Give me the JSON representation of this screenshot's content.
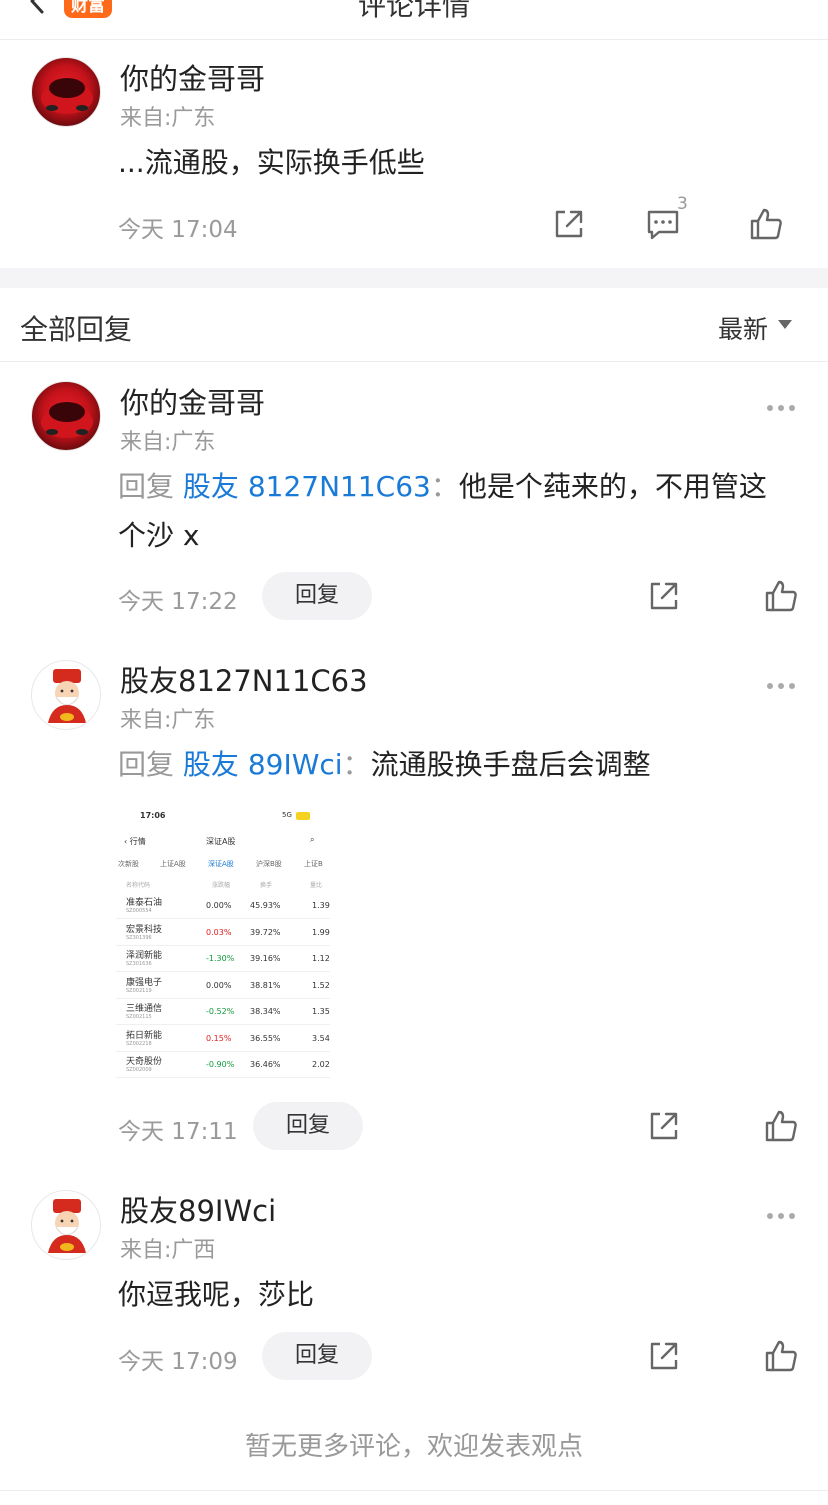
{
  "header": {
    "title": "评论详情",
    "brand_badge": "财富"
  },
  "main_post": {
    "username": "你的金哥哥",
    "region": "来自:广东",
    "content": "...流通股，实际换手低些",
    "time": "今天 17:04",
    "reply_count": "3"
  },
  "replies_section": {
    "title": "全部回复",
    "sort_label": "最新"
  },
  "replies": [
    {
      "username": "你的金哥哥",
      "region": "来自:广东",
      "reply_prefix": "回复",
      "mention": "股友 8127N11C63",
      "colon": "：",
      "text_line1": "他是个莼来的，不用管这",
      "text_line2": "个沙 x",
      "time": "今天 17:22",
      "reply_label": "回复"
    },
    {
      "username": "股友8127N11C63",
      "region": "来自:广东",
      "reply_prefix": "回复",
      "mention": "股友 89IWci",
      "colon": "：",
      "text_line1": "流通股换手盘后会调整",
      "time": "今天 17:11",
      "reply_label": "回复"
    },
    {
      "username": "股友89IWci",
      "region": "来自:广西",
      "text_line1": "你逗我呢，莎比",
      "time": "今天 17:09",
      "reply_label": "回复"
    }
  ],
  "embedded_screenshot": {
    "status_time": "17:06",
    "status_net": "5G",
    "nav_back": "行情",
    "nav_title": "深证A股",
    "tabs": [
      "次新股",
      "上证A股",
      "深证A股",
      "沪深B股",
      "上证B"
    ],
    "columns": [
      "名称代码",
      "涨跌幅",
      "换手",
      "量比"
    ],
    "rows": [
      {
        "name": "准泰石油",
        "code": "SZ000554",
        "pct": "0.00%",
        "turn": "45.93%",
        "last": "1.39",
        "dir": "flat"
      },
      {
        "name": "宏景科技",
        "code": "SZ301396",
        "pct": "0.03%",
        "turn": "39.72%",
        "last": "1.99",
        "dir": "up"
      },
      {
        "name": "泽润新能",
        "code": "SZ301636",
        "pct": "-1.30%",
        "turn": "39.16%",
        "last": "1.12",
        "dir": "down"
      },
      {
        "name": "康强电子",
        "code": "SZ002119",
        "pct": "0.00%",
        "turn": "38.81%",
        "last": "1.52",
        "dir": "flat"
      },
      {
        "name": "三维通信",
        "code": "SZ002115",
        "pct": "-0.52%",
        "turn": "38.34%",
        "last": "1.35",
        "dir": "down"
      },
      {
        "name": "拓日新能",
        "code": "SZ002218",
        "pct": "0.15%",
        "turn": "36.55%",
        "last": "3.54",
        "dir": "up"
      },
      {
        "name": "天奇股份",
        "code": "SZ002009",
        "pct": "-0.90%",
        "turn": "36.46%",
        "last": "2.02",
        "dir": "down"
      }
    ]
  },
  "footer": {
    "note": "暂无更多评论，欢迎发表观点"
  },
  "colors": {
    "mention": "#1a7ad8",
    "brand": "#ff6a1a",
    "muted": "#9a9a9a",
    "up": "#e02020",
    "down": "#119a3a"
  }
}
